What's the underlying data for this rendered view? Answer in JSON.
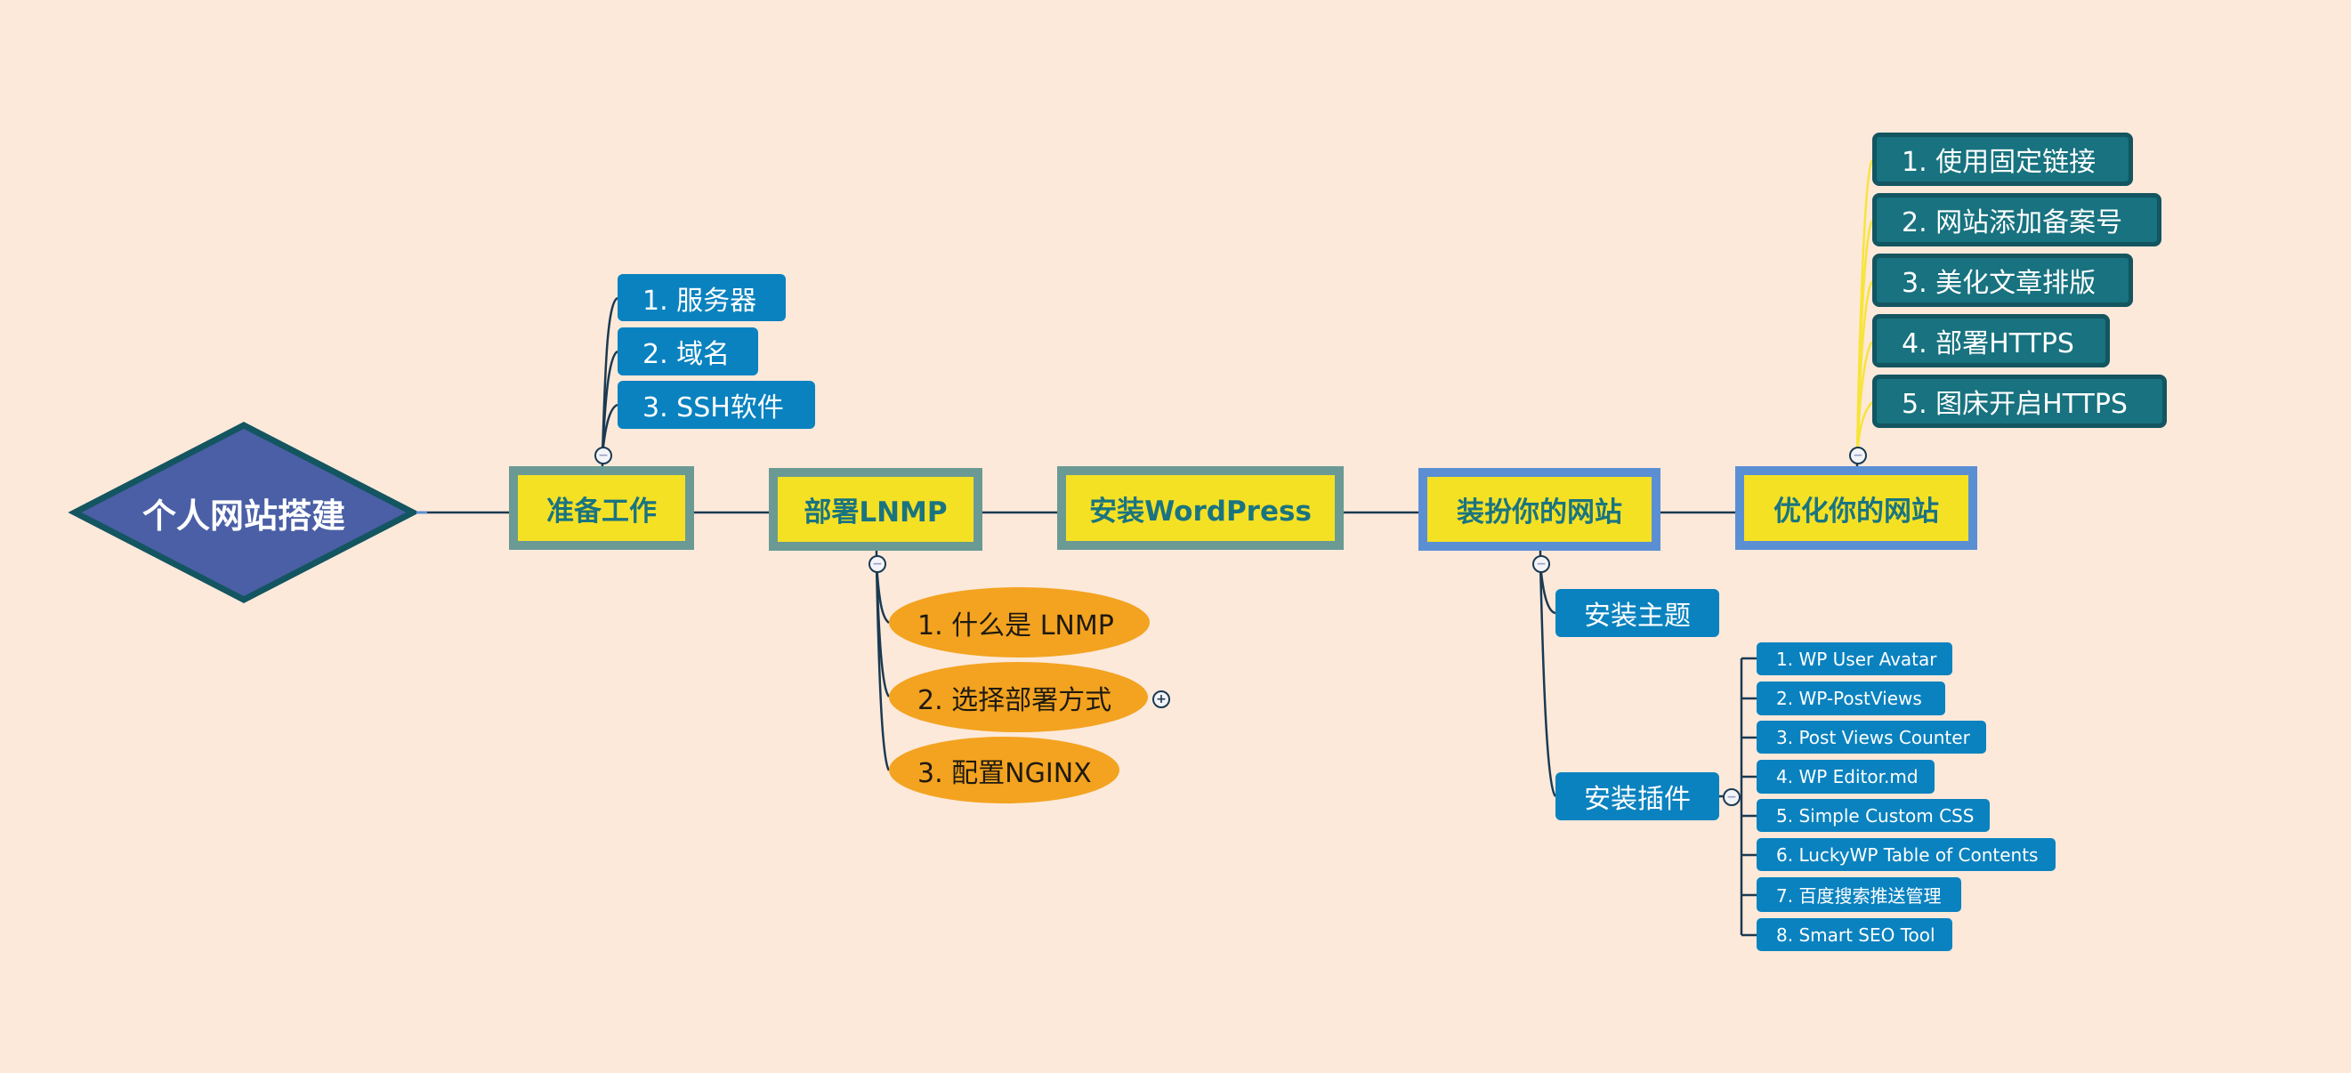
{
  "root": {
    "label": "个人网站搭建",
    "fill": "#4a5fa5",
    "stroke": "#135560"
  },
  "main_topics": [
    {
      "label": "准备工作",
      "border": "#6a9a93"
    },
    {
      "label": "部署LNMP",
      "border": "#6a9a93"
    },
    {
      "label": "安装WordPress",
      "border": "#6a9a93"
    },
    {
      "label": "装扮你的网站",
      "border": "#5b8fd4"
    },
    {
      "label": "优化你的网站",
      "border": "#5b8fd4"
    }
  ],
  "prep": {
    "items": [
      "1. 服务器",
      "2. 域名",
      "3. SSH软件"
    ]
  },
  "lnmp": {
    "items": [
      "1. 什么是 LNMP",
      "2. 选择部署方式",
      "3. 配置NGINX"
    ]
  },
  "decorate": {
    "theme": "安装主题",
    "plugins_label": "安装插件",
    "plugins": [
      "1. WP User Avatar",
      "2. WP-PostViews",
      "3. Post Views Counter",
      "4. WP Editor.md",
      "5. Simple Custom CSS",
      "6. LuckyWP Table of Contents",
      "7. 百度搜索推送管理",
      "8. Smart SEO Tool"
    ]
  },
  "optimize": {
    "items": [
      "1. 使用固定链接",
      "2. 网站添加备案号",
      "3. 美化文章排版",
      "4. 部署HTTPS",
      "5. 图床开启HTTPS"
    ]
  },
  "toggles": {
    "collapse": "−",
    "expand": "+"
  },
  "colors": {
    "background": "#fde9da",
    "main_fill": "#f5e124",
    "main_text": "#1a7480",
    "blue_node": "#0a82bf",
    "teal_node": "#18727f",
    "orange_node": "#f3a320",
    "line": "#1b3a52",
    "yellow_line": "#f7e43a"
  }
}
